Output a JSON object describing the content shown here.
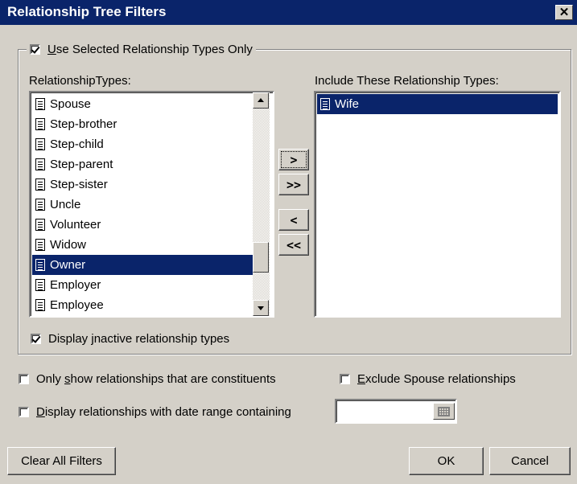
{
  "window": {
    "title": "Relationship Tree Filters",
    "close_glyph": "✕"
  },
  "group": {
    "use_selected_label": "Use Selected Relationship Types Only",
    "use_selected_checked": true
  },
  "types": {
    "label": "RelationshipTypes:",
    "items": [
      "Spouse",
      "Step-brother",
      "Step-child",
      "Step-parent",
      "Step-sister",
      "Uncle",
      "Volunteer",
      "Widow",
      "Owner",
      "Employer",
      "Employee"
    ],
    "selected": "Owner"
  },
  "include": {
    "label": "Include These Relationship Types:",
    "items": [
      "Wife"
    ],
    "selected": "Wife"
  },
  "move_buttons": {
    "add": ">",
    "add_all": ">>",
    "remove": "<",
    "remove_all": "<<"
  },
  "display_inactive": {
    "label": "Display inactive relationship types",
    "checked": true
  },
  "only_constituents": {
    "label": "Only show relationships that are constituents",
    "checked": false
  },
  "exclude_spouse": {
    "label": "Exclude Spouse relationships",
    "checked": false
  },
  "date_range": {
    "label": "Display relationships with date range containing",
    "checked": false,
    "value": ""
  },
  "buttons": {
    "clear": "Clear All Filters",
    "ok": "OK",
    "cancel": "Cancel"
  },
  "icons": {
    "list_item": "document-icon",
    "calendar": "calendar-icon",
    "scroll_up": "arrow-up-icon",
    "scroll_down": "arrow-down-icon"
  }
}
